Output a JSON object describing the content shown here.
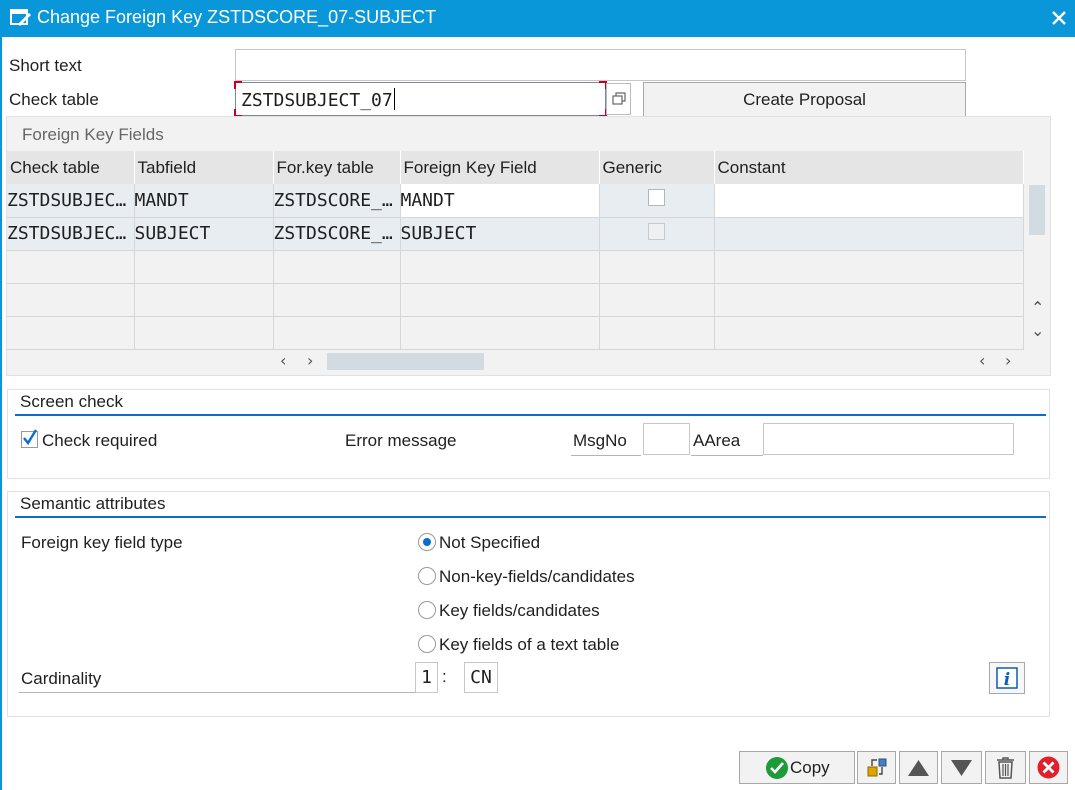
{
  "window": {
    "title": "Change Foreign Key ZSTDSCORE_07-SUBJECT",
    "icons": {
      "app": "edit-window-icon",
      "close": "close-icon"
    }
  },
  "header": {
    "short_text_label": "Short text",
    "short_text_value": "",
    "check_table_label": "Check table",
    "check_table_value": "ZSTDSUBJECT_07",
    "create_proposal_label": "Create Proposal"
  },
  "fk_fields": {
    "title": "Foreign Key Fields",
    "columns": [
      "Check table",
      "Tabfield",
      "For.key table",
      "Foreign Key Field",
      "Generic",
      "Constant"
    ],
    "rows": [
      {
        "check_table": "ZSTDSUBJEC…",
        "tabfield": "MANDT",
        "for_key_table": "ZSTDSCORE_…",
        "fk_field": "MANDT",
        "generic": false,
        "constant": ""
      },
      {
        "check_table": "ZSTDSUBJEC…",
        "tabfield": "SUBJECT",
        "for_key_table": "ZSTDSCORE_…",
        "fk_field": "SUBJECT",
        "generic": false,
        "constant": ""
      }
    ]
  },
  "screen_check": {
    "title": "Screen check",
    "check_required_label": "Check required",
    "check_required": true,
    "error_message_label": "Error message",
    "msgno_label": "MsgNo",
    "msgno_value": "",
    "aarea_label": "AArea",
    "aarea_value": ""
  },
  "semantic": {
    "title": "Semantic attributes",
    "fk_type_label": "Foreign key field type",
    "options": [
      "Not Specified",
      "Non-key-fields/candidates",
      "Key fields/candidates",
      "Key fields of a text table"
    ],
    "selected_index": 0,
    "cardinality_label": "Cardinality",
    "cardinality_left": "1",
    "cardinality_sep": ":",
    "cardinality_right": "CN"
  },
  "toolbar": {
    "copy_label": "Copy",
    "icons": [
      "check-icon",
      "transfer-icon",
      "triangle-up-icon",
      "triangle-down-icon",
      "trash-icon",
      "cancel-icon"
    ]
  },
  "colors": {
    "title_bar": "#0a97d9",
    "accent": "#0a6ed1",
    "cancel": "#e0202a",
    "confirm": "#1d9a3a"
  }
}
